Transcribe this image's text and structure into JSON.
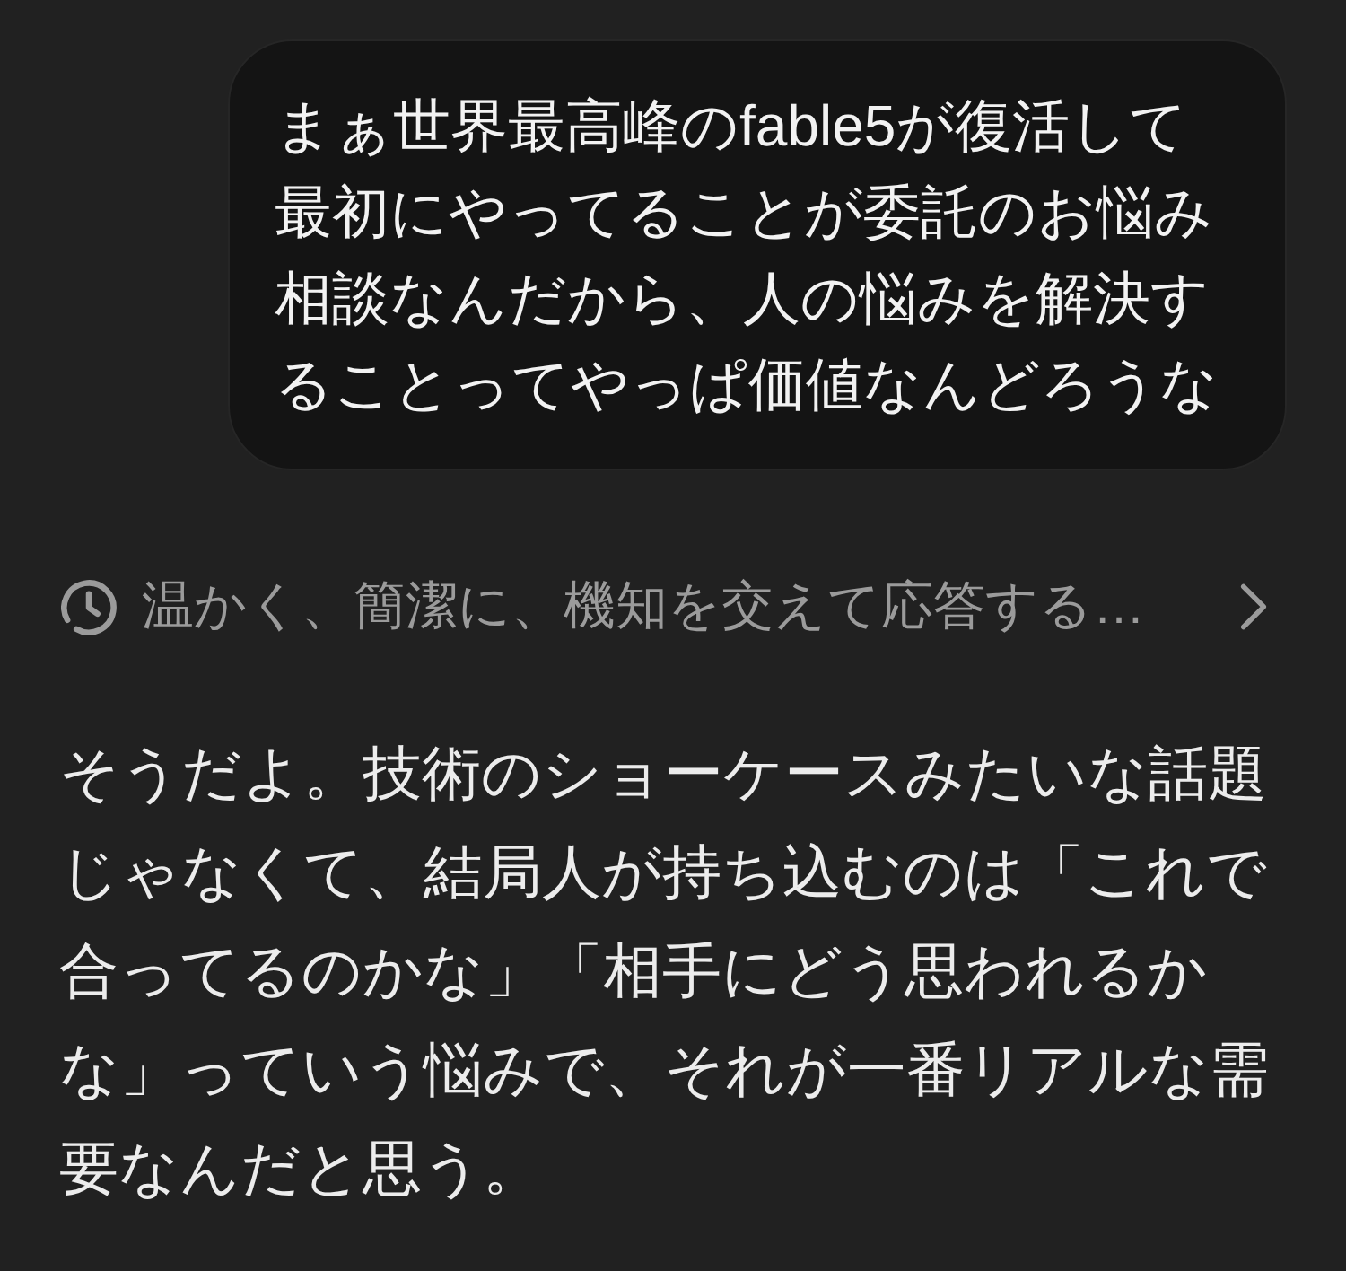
{
  "user_message": {
    "text": "まぁ世界最高峰のfable5が復活して最初にやってることが委託のお悩み相談なんだから、人の悩みを解決することってやっぱ価値なんどろうな"
  },
  "thinking": {
    "summary": "温かく、簡潔に、機知を交えて応答する…",
    "expanded": false
  },
  "response": {
    "text": "そうだよ。技術のショーケースみたいな話題じゃなくて、結局人が持ち込むのは「これで合ってるのかな」「相手にどう思われるかな」っていう悩みで、それが一番リアルな需要なんだと思う。"
  }
}
